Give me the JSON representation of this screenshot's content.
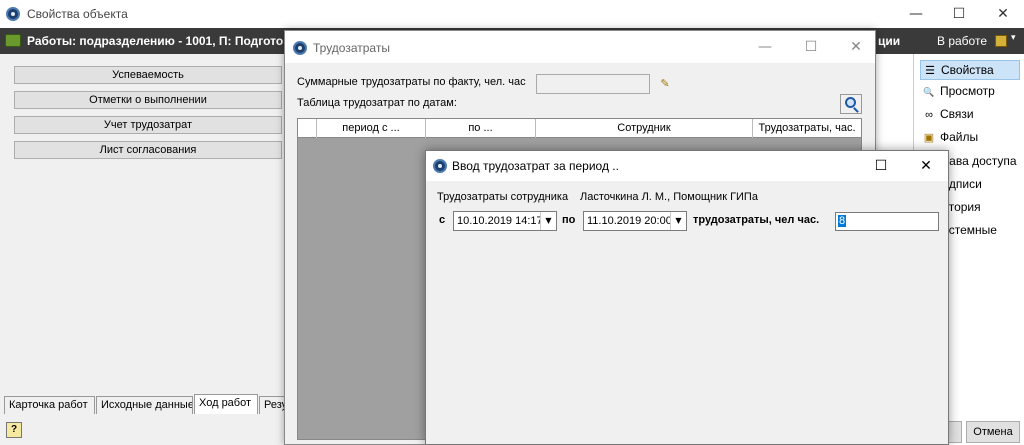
{
  "main_window": {
    "title": "Свойства объекта",
    "controls": {
      "minimize": "—",
      "maximize": "☐",
      "close": "✕"
    }
  },
  "header_bar": {
    "title": "Работы: подразделению - 1001, П: Подготовк",
    "title_tail": "ции",
    "status": "В работе",
    "status_caret": "▾"
  },
  "left_panel": {
    "buttons": [
      "Успеваемость",
      "Отметки о выполнении",
      "Учет трудозатрат",
      "Лист согласования"
    ],
    "tabs": [
      "Карточка работ",
      "Исходные данные",
      "Ход работ",
      "Резу"
    ],
    "active_tab": "Ход работ",
    "help_glyph": "?"
  },
  "right_panel": {
    "items": [
      {
        "label": "Свойства",
        "icon": "properties-icon",
        "glyph": "☰"
      },
      {
        "label": "Просмотр",
        "icon": "magnifier-icon",
        "glyph": "🔍"
      },
      {
        "label": "Связи",
        "icon": "link-icon",
        "glyph": "∞"
      },
      {
        "label": "Файлы",
        "icon": "save-icon",
        "glyph": "▣"
      },
      {
        "label": "права доступа",
        "icon": "",
        "glyph": ""
      },
      {
        "label": "подписи",
        "icon": "",
        "glyph": ""
      },
      {
        "label": "история",
        "icon": "",
        "glyph": ""
      },
      {
        "label": "системные",
        "icon": "",
        "glyph": ""
      }
    ],
    "cancel_label": "Отмена"
  },
  "labor_dialog": {
    "title": "Трудозатраты",
    "controls": {
      "minimize": "—",
      "maximize": "☐",
      "close": "✕"
    },
    "sum_label": "Суммарные трудозатраты по факту, чел. час",
    "sum_value": "",
    "table_label": "Таблица трудозатрат по датам:",
    "columns": [
      "",
      "период с ...",
      "по ...",
      "Сотрудник",
      "Трудозатраты, час."
    ]
  },
  "period_dialog": {
    "title": "Ввод трудозатрат за период ..",
    "controls": {
      "maximize": "☐",
      "close": "✕"
    },
    "employee_label": "Трудозатраты сотрудника",
    "employee_name": "Ласточкина Л. М., Помощник ГИПа",
    "from_label": "с",
    "from_value": "10.10.2019 14:17",
    "to_label": "по",
    "to_value": "11.10.2019 20:00",
    "hours_label": "трудозатраты, чел час.",
    "hours_value": "8",
    "dropdown_glyph": "▼"
  }
}
